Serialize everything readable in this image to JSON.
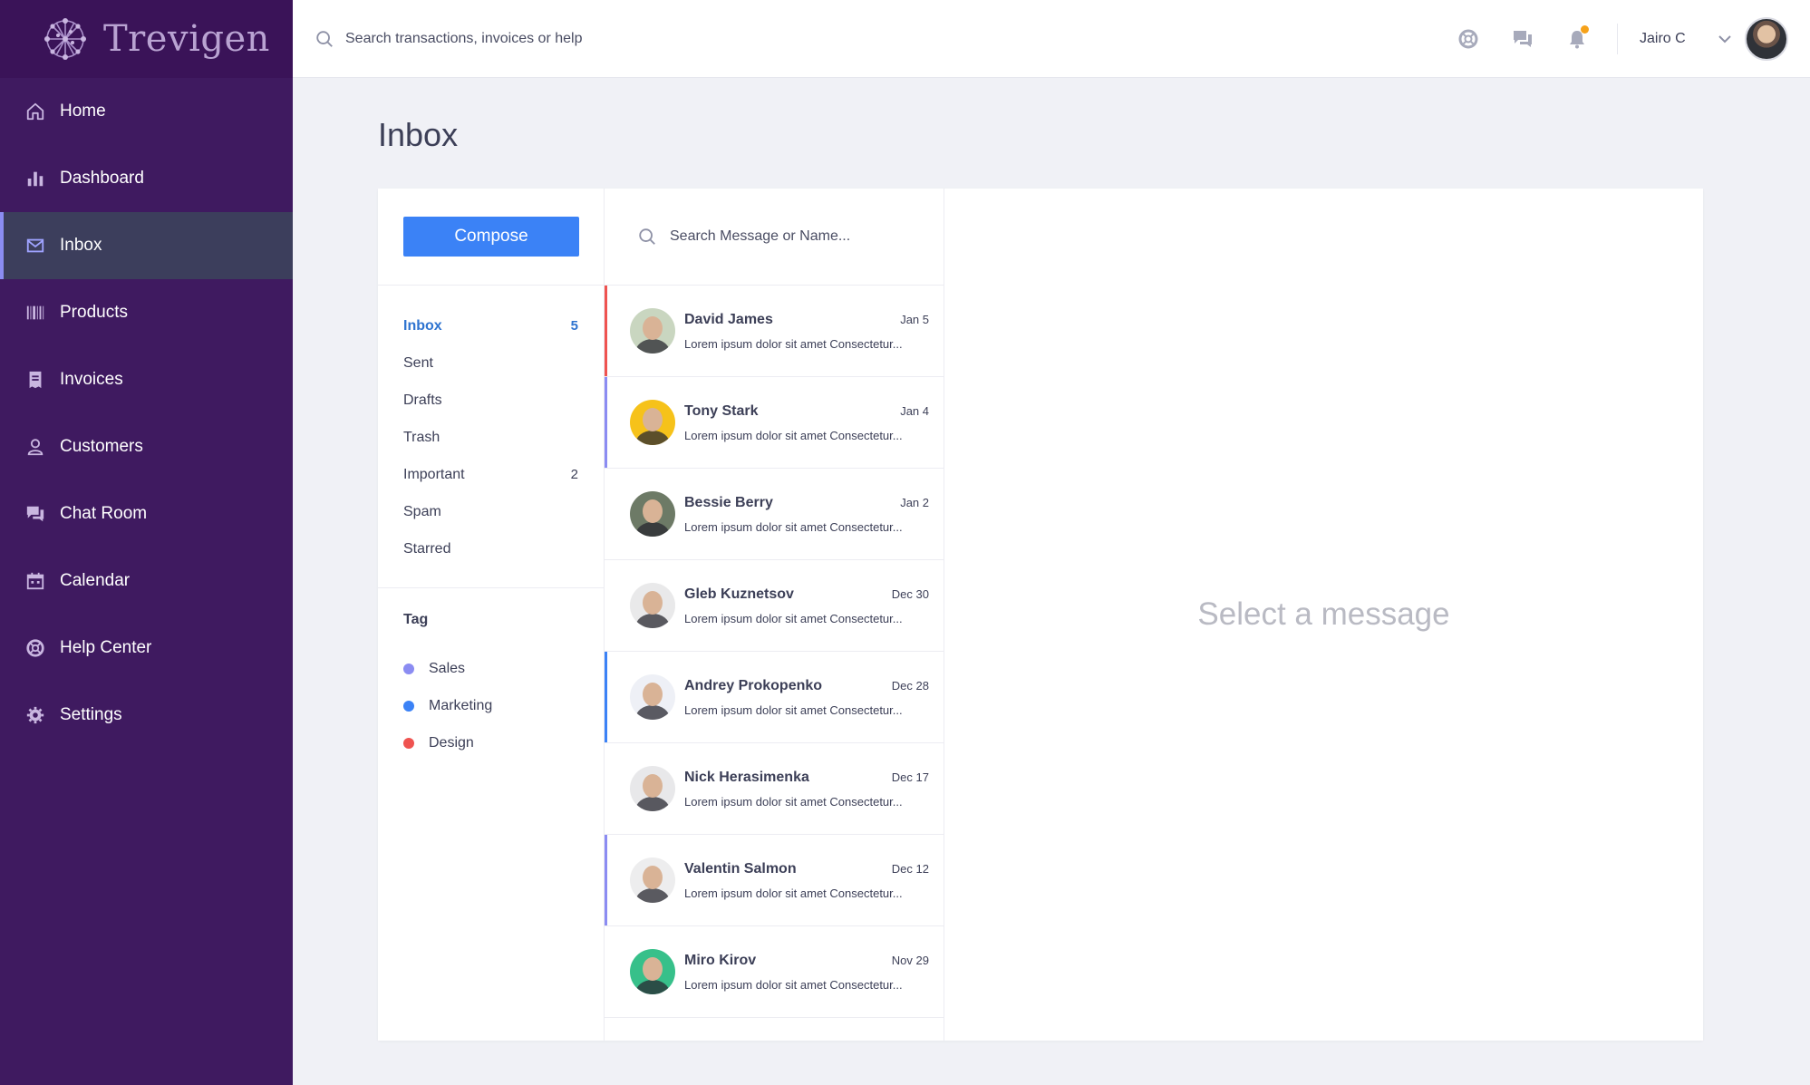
{
  "brand": {
    "name": "Trevigen"
  },
  "sidebar": {
    "items": [
      {
        "label": "Home",
        "icon": "home-icon",
        "active": false
      },
      {
        "label": "Dashboard",
        "icon": "bar-chart-icon",
        "active": false
      },
      {
        "label": "Inbox",
        "icon": "mail-icon",
        "active": true
      },
      {
        "label": "Products",
        "icon": "barcode-icon",
        "active": false
      },
      {
        "label": "Invoices",
        "icon": "receipt-icon",
        "active": false
      },
      {
        "label": "Customers",
        "icon": "user-icon",
        "active": false
      },
      {
        "label": "Chat Room",
        "icon": "chat-icon",
        "active": false
      },
      {
        "label": "Calendar",
        "icon": "calendar-icon",
        "active": false
      },
      {
        "label": "Help Center",
        "icon": "lifebuoy-icon",
        "active": false
      },
      {
        "label": "Settings",
        "icon": "gear-icon",
        "active": false
      }
    ]
  },
  "header": {
    "search_placeholder": "Search transactions, invoices or help",
    "icons": [
      "lifebuoy-icon",
      "chat-icon",
      "bell-icon"
    ],
    "user_name": "Jairo C"
  },
  "page": {
    "title": "Inbox"
  },
  "compose": {
    "label": "Compose"
  },
  "folders": [
    {
      "label": "Inbox",
      "count": "5",
      "active": true
    },
    {
      "label": "Sent",
      "count": ""
    },
    {
      "label": "Drafts",
      "count": ""
    },
    {
      "label": "Trash",
      "count": ""
    },
    {
      "label": "Important",
      "count": "2"
    },
    {
      "label": "Spam",
      "count": ""
    },
    {
      "label": "Starred",
      "count": ""
    }
  ],
  "tags": {
    "title": "Tag",
    "items": [
      {
        "label": "Sales",
        "color": "#8b8cf2"
      },
      {
        "label": "Marketing",
        "color": "#3b82f6"
      },
      {
        "label": "Design",
        "color": "#ef5350"
      }
    ]
  },
  "message_search": {
    "placeholder": "Search Message or Name..."
  },
  "messages": [
    {
      "name": "David James",
      "date": "Jan 5",
      "preview": "Lorem ipsum dolor sit amet Consectetur...",
      "tag_color": "#ef5350",
      "avatar_bg": "#c9d6c0"
    },
    {
      "name": "Tony Stark",
      "date": "Jan 4",
      "preview": "Lorem ipsum dolor sit amet Consectetur...",
      "tag_color": "#8b8cf2",
      "avatar_bg": "#f6c21a"
    },
    {
      "name": "Bessie Berry",
      "date": "Jan 2",
      "preview": "Lorem ipsum dolor sit amet Consectetur...",
      "tag_color": "",
      "avatar_bg": "#6d7a66"
    },
    {
      "name": "Gleb Kuznetsov",
      "date": "Dec 30",
      "preview": "Lorem ipsum dolor sit amet Consectetur...",
      "tag_color": "",
      "avatar_bg": "#e9e9ea"
    },
    {
      "name": "Andrey Prokopenko",
      "date": "Dec 28",
      "preview": "Lorem ipsum dolor sit amet Consectetur...",
      "tag_color": "#3b82f6",
      "avatar_bg": "#eef0f6"
    },
    {
      "name": "Nick Herasimenka",
      "date": "Dec 17",
      "preview": "Lorem ipsum dolor sit amet Consectetur...",
      "tag_color": "",
      "avatar_bg": "#e8e8ea"
    },
    {
      "name": "Valentin Salmon",
      "date": "Dec 12",
      "preview": "Lorem ipsum dolor sit amet Consectetur...",
      "tag_color": "#8b8cf2",
      "avatar_bg": "#ededee"
    },
    {
      "name": "Miro Kirov",
      "date": "Nov 29",
      "preview": "Lorem ipsum dolor sit amet Consectetur...",
      "tag_color": "",
      "avatar_bg": "#37c08a"
    }
  ],
  "viewer": {
    "empty_text": "Select a message"
  },
  "colors": {
    "sidebar": "#3f1a60",
    "accent": "#3b82f6",
    "active_indicator": "#8b8cf2",
    "notification_dot": "#f6a21a"
  }
}
